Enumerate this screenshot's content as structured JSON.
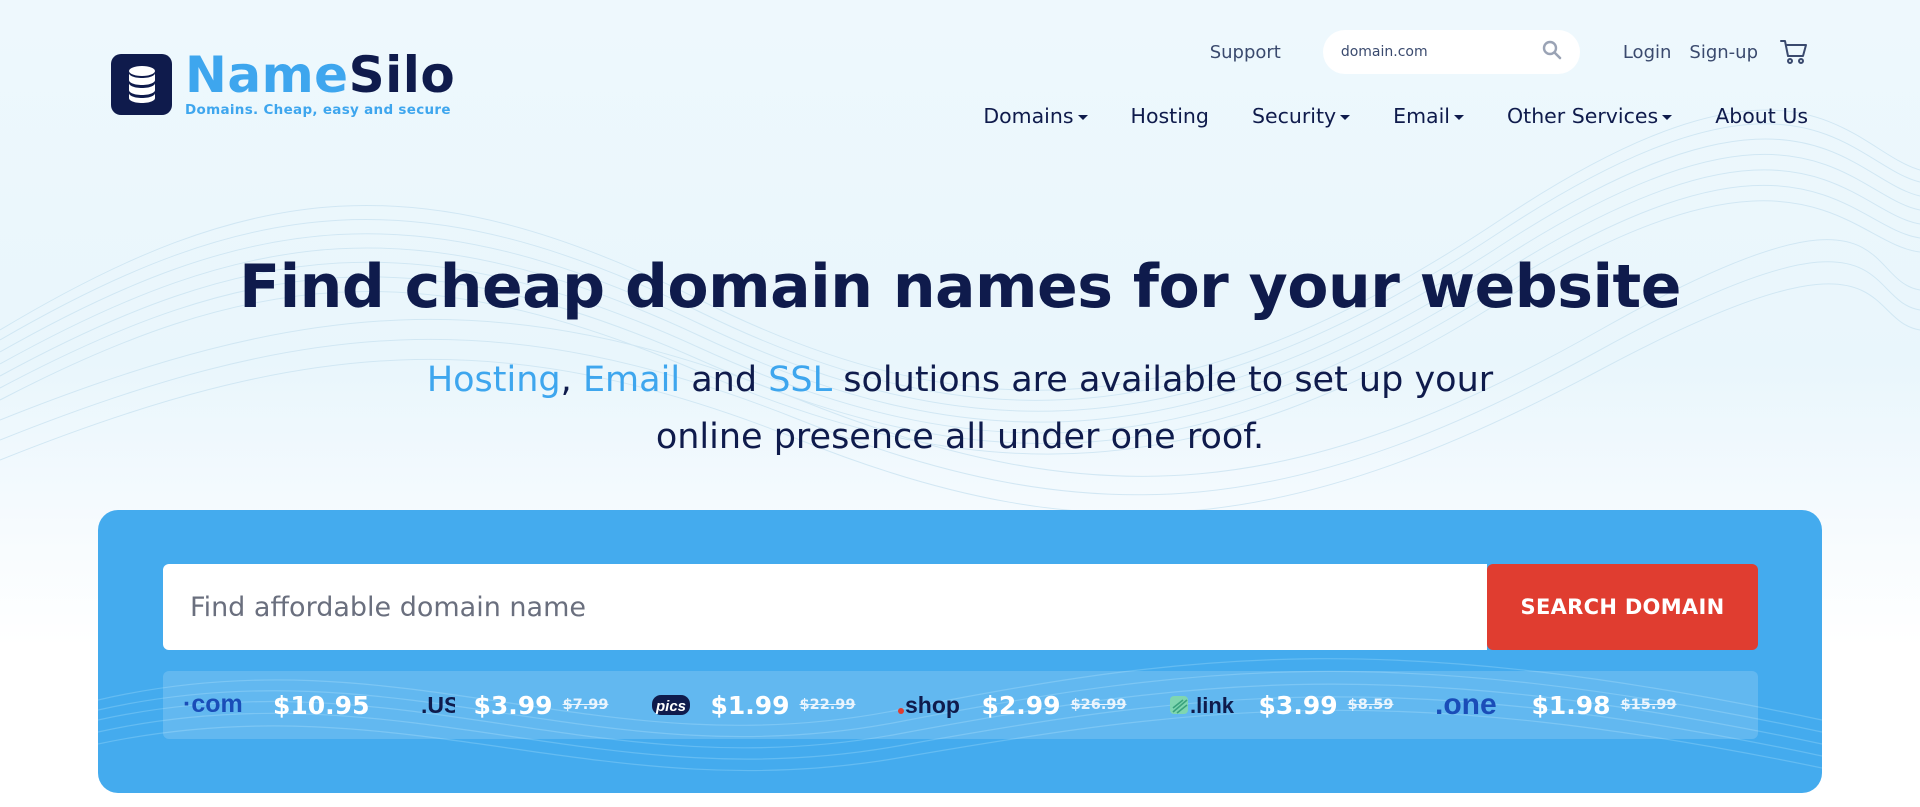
{
  "brand": {
    "name_part1": "Name",
    "name_part2": "Silo",
    "tagline": "Domains. Cheap, easy and secure",
    "accent": "#3ea6ee",
    "navy": "#0f1b4c"
  },
  "top_links": {
    "support": "Support",
    "search_placeholder": "domain.com",
    "login": "Login",
    "signup": "Sign-up"
  },
  "nav": [
    {
      "label": "Domains",
      "dropdown": true
    },
    {
      "label": "Hosting",
      "dropdown": false
    },
    {
      "label": "Security",
      "dropdown": true
    },
    {
      "label": "Email",
      "dropdown": true
    },
    {
      "label": "Other Services",
      "dropdown": true
    },
    {
      "label": "About Us",
      "dropdown": false
    }
  ],
  "hero": {
    "title": "Find cheap domain names for your website",
    "sub_hosting": "Hosting",
    "sub_comma": ",",
    "sub_email": "Email",
    "sub_and": "and",
    "sub_ssl": "SSL",
    "sub_rest1": "solutions are available to set up your",
    "sub_line2": "online presence all under one roof."
  },
  "search": {
    "placeholder": "Find affordable domain name",
    "button_label": "SEARCH DOMAIN",
    "button_color": "#e03d30",
    "panel_color": "#44abee"
  },
  "tlds": [
    {
      "name": ".com",
      "price": "$10.95",
      "old": ""
    },
    {
      "name": ".us",
      "price": "$3.99",
      "old": "$7.99"
    },
    {
      "name": ".pics",
      "price": "$1.99",
      "old": "$22.99"
    },
    {
      "name": ".shop",
      "price": "$2.99",
      "old": "$26.99"
    },
    {
      "name": ".link",
      "price": "$3.99",
      "old": "$8.59"
    },
    {
      "name": ".one",
      "price": "$1.98",
      "old": "$15.99"
    }
  ],
  "icons": [
    "database-logo-icon",
    "search-icon",
    "cart-icon",
    "caret-down-icon"
  ]
}
